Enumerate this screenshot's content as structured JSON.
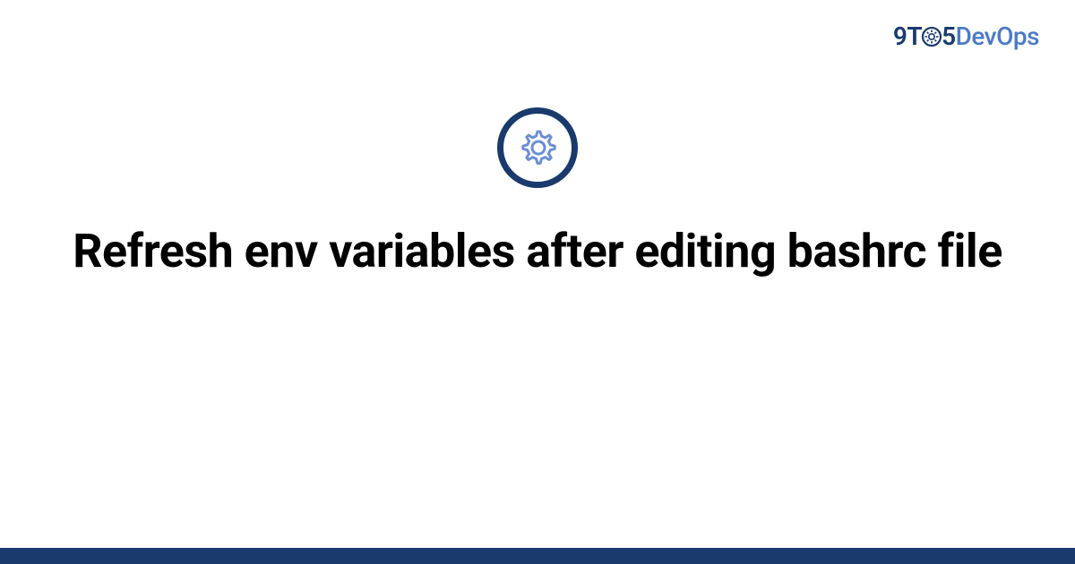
{
  "brand": {
    "part1": "9T",
    "part2": "5",
    "part3": "Dev",
    "part4": "Ops"
  },
  "title": "Refresh env variables after editing bashrc file",
  "colors": {
    "brand_dark": "#1a3a6e",
    "brand_light": "#4a7bc8",
    "gear_stroke": "#6b8fd4"
  }
}
